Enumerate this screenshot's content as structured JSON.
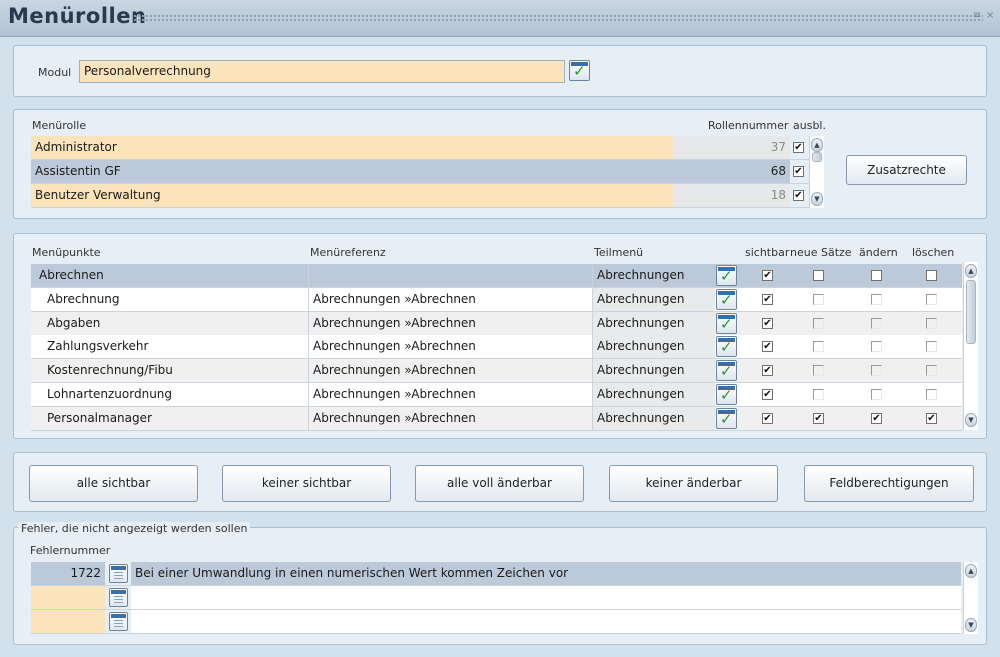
{
  "window": {
    "title": "Menürollen"
  },
  "modul": {
    "label": "Modul",
    "value": "Personalverrechnung"
  },
  "roles": {
    "header_role": "Menürolle",
    "header_number": "Rollennummer",
    "header_hidden": "ausbl.",
    "rows": [
      {
        "name": "Administrator",
        "number": "37",
        "hidden": "✔"
      },
      {
        "name": "Assistentin GF",
        "number": "68",
        "hidden": "✔"
      },
      {
        "name": "Benutzer Verwaltung",
        "number": "18",
        "hidden": "✔"
      }
    ],
    "zusatzrechte_label": "Zusatzrechte"
  },
  "menu": {
    "headers": {
      "punkte": "Menüpunkte",
      "referenz": "Menüreferenz",
      "teilmenu": "Teilmenü",
      "sichtbar": "sichtbar",
      "neue": "neue Sätze",
      "aendern": "ändern",
      "loeschen": "löschen"
    },
    "rows": [
      {
        "punkt": "Abrechnen",
        "referenz": "",
        "teilmenu": "Abrechnungen",
        "sichtbar": "✔",
        "neue": "",
        "aendern": "",
        "loeschen": ""
      },
      {
        "punkt": "Abrechnung",
        "referenz": "Abrechnungen »Abrechnen",
        "teilmenu": "Abrechnungen",
        "sichtbar": "✔",
        "neue": "",
        "aendern": "",
        "loeschen": ""
      },
      {
        "punkt": "Abgaben",
        "referenz": "Abrechnungen »Abrechnen",
        "teilmenu": "Abrechnungen",
        "sichtbar": "✔",
        "neue": "",
        "aendern": "",
        "loeschen": ""
      },
      {
        "punkt": "Zahlungsverkehr",
        "referenz": "Abrechnungen »Abrechnen",
        "teilmenu": "Abrechnungen",
        "sichtbar": "✔",
        "neue": "",
        "aendern": "",
        "loeschen": ""
      },
      {
        "punkt": "Kostenrechnung/Fibu",
        "referenz": "Abrechnungen »Abrechnen",
        "teilmenu": "Abrechnungen",
        "sichtbar": "✔",
        "neue": "",
        "aendern": "",
        "loeschen": ""
      },
      {
        "punkt": "Lohnartenzuordnung",
        "referenz": "Abrechnungen »Abrechnen",
        "teilmenu": "Abrechnungen",
        "sichtbar": "✔",
        "neue": "",
        "aendern": "",
        "loeschen": ""
      },
      {
        "punkt": "Personalmanager",
        "referenz": "Abrechnungen »Abrechnen",
        "teilmenu": "Abrechnungen",
        "sichtbar": "✔",
        "neue": "✔",
        "aendern": "✔",
        "loeschen": "✔"
      }
    ]
  },
  "buttons": {
    "alle_sichtbar": "alle sichtbar",
    "keiner_sichtbar": "keiner sichtbar",
    "alle_voll": "alle voll änderbar",
    "keiner_aenderbar": "keiner änderbar",
    "feldberechtigungen": "Feldberechtigungen"
  },
  "errors": {
    "group_title": "Fehler, die nicht angezeigt werden sollen",
    "header_number": "Fehlernummer",
    "rows": [
      {
        "number": "1722",
        "text": "Bei einer Umwandlung in einen numerischen Wert kommen Zeichen vor"
      },
      {
        "number": "",
        "text": ""
      },
      {
        "number": "",
        "text": ""
      }
    ]
  }
}
